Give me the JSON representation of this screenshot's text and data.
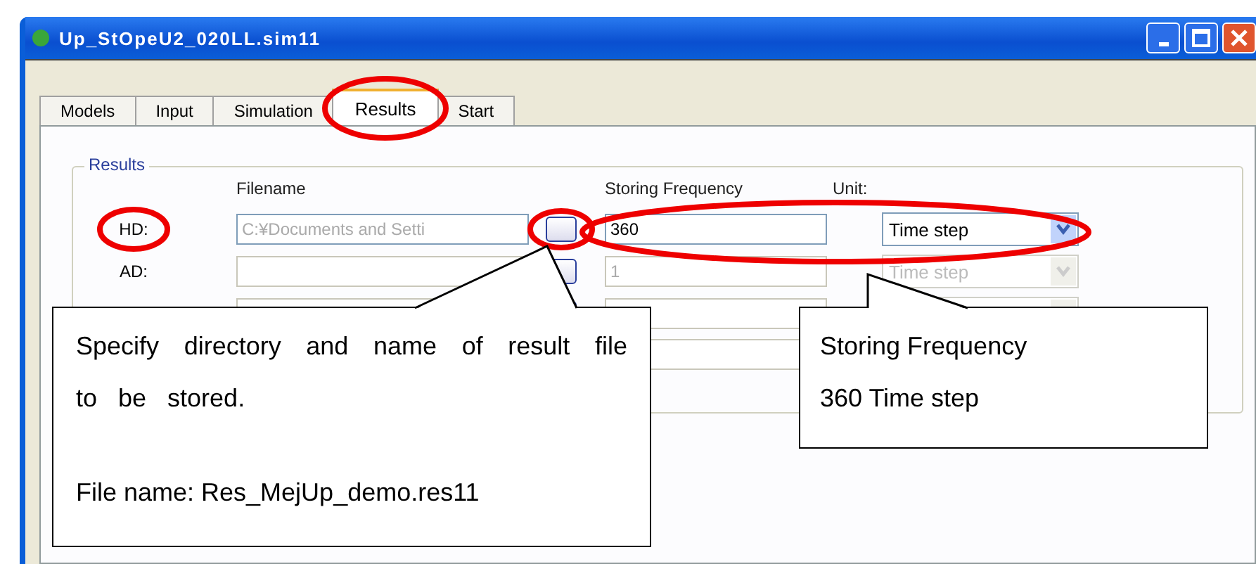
{
  "window": {
    "title": "Up_StOpeU2_020LL.sim11"
  },
  "tabs": [
    {
      "label": "Models",
      "selected": false
    },
    {
      "label": "Input",
      "selected": false
    },
    {
      "label": "Simulation",
      "selected": false
    },
    {
      "label": "Results",
      "selected": true
    },
    {
      "label": "Start",
      "selected": false
    }
  ],
  "group": {
    "title": "Results",
    "columns": [
      "Filename",
      "Storing Frequency",
      "Unit:"
    ],
    "rows": [
      {
        "kind": "full",
        "label": "HD:",
        "filename": "C:¥Documents and Setti",
        "frequency": "360",
        "unit": "Time step",
        "disabled": false
      },
      {
        "kind": "full",
        "label": "AD:",
        "filename": "",
        "frequency": "1",
        "unit": "Time step",
        "disabled": true
      },
      {
        "kind": "full",
        "disabled": true
      },
      {
        "kind": "partial",
        "disabled": true
      }
    ]
  },
  "callouts": [
    {
      "lines": [
        "Specify directory and name of result file to be stored.",
        "File name: Res_MejUp_demo.res11"
      ]
    },
    {
      "lines": [
        "Storing Frequency",
        "360 Time step"
      ]
    }
  ]
}
